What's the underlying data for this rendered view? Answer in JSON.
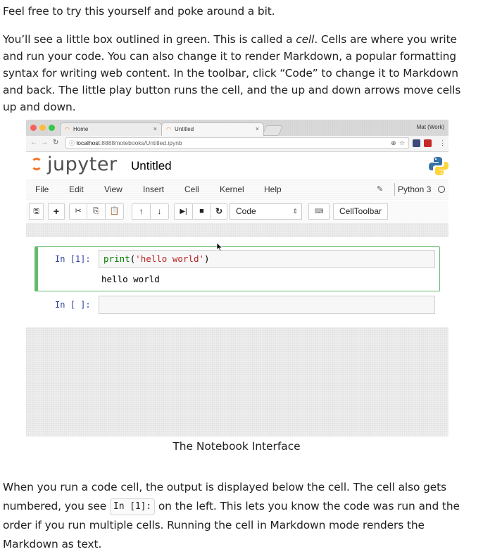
{
  "article": {
    "para1": "Feel free to try this yourself and poke around a bit.",
    "para2_pre": "You’ll see a little box outlined in green. This is called a ",
    "para2_em": "cell",
    "para2_post": ". Cells are where you write and run your code. You can also change it to render Markdown, a popular formatting syntax for writing web content. In the toolbar, click “Code” to change it to Markdown and back. The little play button runs the cell, and the up and down arrows move cells up and down.",
    "caption": "The Notebook Interface",
    "para3_pre": "When you run a code cell, the output is displayed below the cell. The cell also gets numbered, you see ",
    "para3_code": "In [1]:",
    "para3_post": " on the left. This lets you know the code was run and the order if you run multiple cells. Running the cell in Markdown mode renders the Markdown as text."
  },
  "browser": {
    "tabs": [
      {
        "label": "Home",
        "close": "×"
      },
      {
        "label": "Untitled",
        "close": "×"
      }
    ],
    "profile": "Mat (Work)",
    "url_host": "localhost",
    "url_path": ":8888/notebooks/Untitled.ipynb",
    "colors": {
      "red": "#fc605c",
      "yellow": "#fdbc40",
      "green": "#34c84a"
    }
  },
  "jupyter": {
    "logo_text": "jupyter",
    "notebook_title": "Untitled",
    "menu": [
      "File",
      "Edit",
      "View",
      "Insert",
      "Cell",
      "Kernel",
      "Help"
    ],
    "kernel_name": "Python 3",
    "toolbar": {
      "cell_type": "Code",
      "celltoolbar": "CellToolbar"
    },
    "cells": [
      {
        "prompt": "In [1]:",
        "code_fn": "print",
        "code_open": "(",
        "code_str": "'hello world'",
        "code_close": ")",
        "output": "hello world"
      },
      {
        "prompt": "In [ ]:"
      }
    ],
    "accent_color": "#66bb6a",
    "brand_color": "#f37726"
  }
}
